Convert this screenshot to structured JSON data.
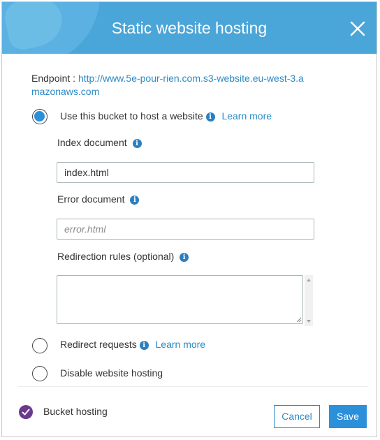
{
  "dialog": {
    "title": "Static website hosting",
    "close_icon": "close-icon"
  },
  "endpoint": {
    "label": "Endpoint : ",
    "url": "http://www.5e-pour-rien.com.s3-website.eu-west-3.amazonaws.com"
  },
  "options": [
    {
      "label": "Use this bucket to host a website",
      "selected": true,
      "learn_more": "Learn more"
    },
    {
      "label": "Redirect requests",
      "selected": false,
      "learn_more": "Learn more"
    },
    {
      "label": "Disable website hosting",
      "selected": false
    }
  ],
  "fields": {
    "index_label": "Index document",
    "index_value": "index.html",
    "error_label": "Error document",
    "error_placeholder": "error.html",
    "redirect_label": "Redirection rules (optional)",
    "redirect_value": ""
  },
  "footer": {
    "status_label": "Bucket hosting",
    "status_icon": "check-circle-icon",
    "status_color": "#6a3a8c",
    "cancel_label": "Cancel",
    "save_label": "Save"
  },
  "colors": {
    "header": "#4aa5d8",
    "accent": "#2b90d9",
    "link": "#2b8ac6"
  }
}
